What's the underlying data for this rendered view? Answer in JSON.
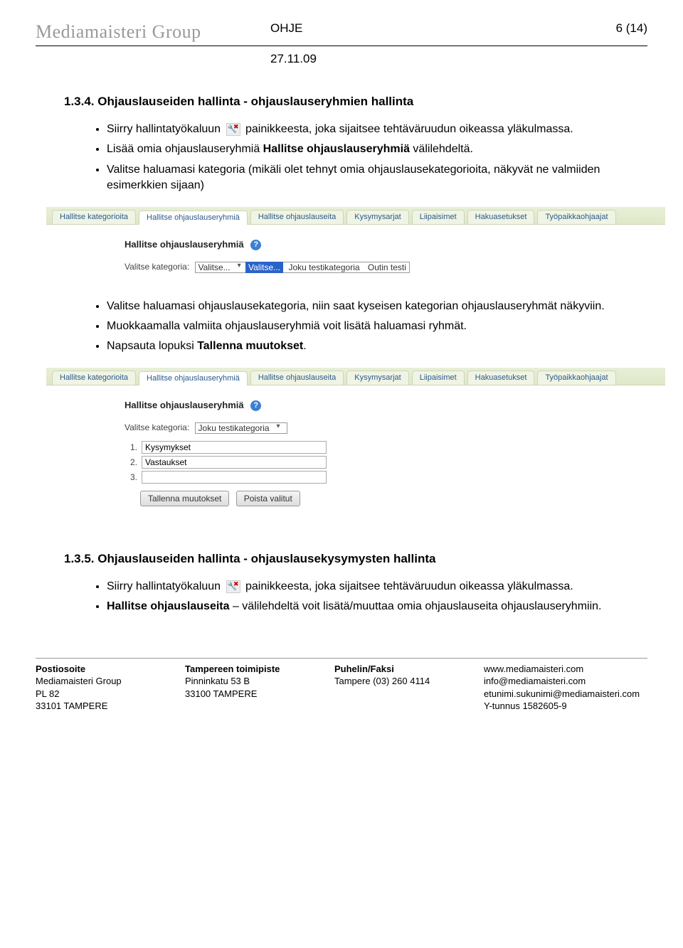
{
  "header": {
    "logo": "Mediamaisteri Group",
    "doc_type": "OHJE",
    "page_num": "6 (14)",
    "date": "27.11.09"
  },
  "section1": {
    "num_title": "1.3.4.  Ohjauslauseiden hallinta - ohjauslauseryhmien hallinta",
    "b1a": "Siirry hallintatyökaluun ",
    "b1b": " painikkeesta, joka sijaitsee tehtäväruudun oikeassa yläkulmassa.",
    "b2": "Lisää omia ohjauslauseryhmiä Hallitse ohjauslauseryhmiä välilehdeltä.",
    "b3": "Valitse haluamasi kategoria (mikäli olet tehnyt omia ohjauslausekategorioita, näkyvät ne valmiiden esimerkkien sijaan)"
  },
  "tabs": {
    "t0": "Hallitse kategorioita",
    "t1": "Hallitse ohjauslauseryhmiä",
    "t2": "Hallitse ohjauslauseita",
    "t3": "Kysymysarjat",
    "t4": "Liipaisimet",
    "t5": "Hakuasetukset",
    "t6": "Työpaikkaohjaajat"
  },
  "shot1": {
    "title": "Hallitse ohjauslauseryhmiä",
    "label": "Valitse kategoria:",
    "sel_head": "Valitse...",
    "opt0": "Valitse...",
    "opt1": "Joku testikategoria",
    "opt2": "Outin testi"
  },
  "mid": {
    "b1": "Valitse haluamasi ohjauslausekategoria, niin saat kyseisen kategorian ohjauslauseryhmät näkyviin.",
    "b2": "Muokkaamalla valmiita ohjauslauseryhmiä voit lisätä haluamasi ryhmät.",
    "b3": "Napsauta lopuksi Tallenna muutokset."
  },
  "shot2": {
    "title": "Hallitse ohjauslauseryhmiä",
    "label": "Valitse kategoria:",
    "sel": "Joku testikategoria",
    "rows": {
      "r1n": "1.",
      "r1v": "Kysymykset",
      "r2n": "2.",
      "r2v": "Vastaukset",
      "r3n": "3.",
      "r3v": ""
    },
    "btn_save": "Tallenna muutokset",
    "btn_del": "Poista valitut"
  },
  "section2": {
    "num_title": "1.3.5.  Ohjauslauseiden hallinta - ohjauslausekysymysten hallinta",
    "b1a": "Siirry hallintatyökaluun ",
    "b1b": " painikkeesta, joka sijaitsee tehtäväruudun oikeassa yläkulmassa.",
    "b2": "Hallitse ohjauslauseita – välilehdeltä voit lisätä/muuttaa omia ohjauslauseita ohjauslauseryhmiin."
  },
  "footer": {
    "c1h": "Postiosoite",
    "c1a": "Mediamaisteri Group",
    "c1b": "PL 82",
    "c1c": "33101 TAMPERE",
    "c2h": "Tampereen toimipiste",
    "c2a": "Pinninkatu  53 B",
    "c2b": "33100 TAMPERE",
    "c3h": "Puhelin/Faksi",
    "c3a": "Tampere (03) 260 4114",
    "c4a": "www.mediamaisteri.com",
    "c4b": "info@mediamaisteri.com",
    "c4c": "etunimi.sukunimi@mediamaisteri.com",
    "c4d": "Y-tunnus 1582605-9"
  }
}
